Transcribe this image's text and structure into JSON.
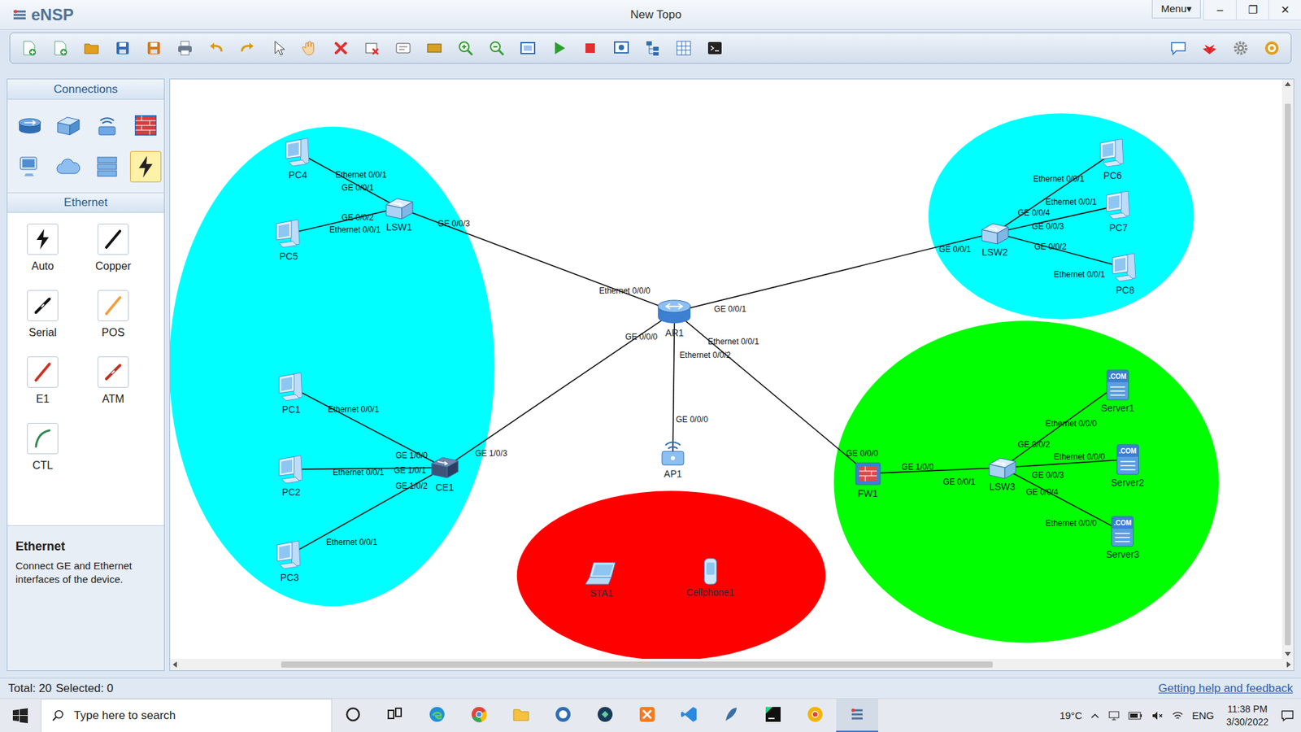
{
  "window": {
    "logo": "eNSP",
    "title": "New Topo",
    "menu": "Menu▾",
    "controls": [
      "–",
      "❐",
      "✕"
    ]
  },
  "palette": {
    "categories_title": "Connections",
    "categories": [
      {
        "kind": "router",
        "selected": false
      },
      {
        "kind": "switch",
        "selected": false
      },
      {
        "kind": "wlan",
        "selected": false
      },
      {
        "kind": "firewall",
        "selected": false
      },
      {
        "kind": "pc",
        "selected": false
      },
      {
        "kind": "cloud",
        "selected": false
      },
      {
        "kind": "other",
        "selected": false
      },
      {
        "kind": "connection",
        "selected": true
      }
    ],
    "cables_title": "Ethernet",
    "cables": [
      {
        "label": "Auto",
        "kind": "auto"
      },
      {
        "label": "Copper",
        "kind": "copper"
      },
      {
        "label": "Serial",
        "kind": "serial"
      },
      {
        "label": "POS",
        "kind": "pos"
      },
      {
        "label": "E1",
        "kind": "e1"
      },
      {
        "label": "ATM",
        "kind": "atm"
      },
      {
        "label": "CTL",
        "kind": "ctl"
      }
    ],
    "info": {
      "title": "Ethernet",
      "text": "Connect GE and Ethernet interfaces of the device."
    }
  },
  "topology": {
    "zones": [
      {
        "color": "#00ffff"
      },
      {
        "color": "#00ffff"
      },
      {
        "color": "#ff0000"
      },
      {
        "color": "#00ff00"
      }
    ],
    "nodes": [
      {
        "label": "PC4",
        "kind": "pc"
      },
      {
        "label": "PC5",
        "kind": "pc"
      },
      {
        "label": "LSW1",
        "kind": "switch"
      },
      {
        "label": "PC1",
        "kind": "pc"
      },
      {
        "label": "PC2",
        "kind": "pc"
      },
      {
        "label": "PC3",
        "kind": "pc"
      },
      {
        "label": "CE1",
        "kind": "ce"
      },
      {
        "label": "AR1",
        "kind": "router"
      },
      {
        "label": "AP1",
        "kind": "ap"
      },
      {
        "label": "STA1",
        "kind": "laptop"
      },
      {
        "label": "Cellphone1",
        "kind": "phone"
      },
      {
        "label": "LSW2",
        "kind": "switch"
      },
      {
        "label": "PC6",
        "kind": "pc"
      },
      {
        "label": "PC7",
        "kind": "pc"
      },
      {
        "label": "PC8",
        "kind": "pc"
      },
      {
        "label": "FW1",
        "kind": "firewall"
      },
      {
        "label": "LSW3",
        "kind": "switch"
      },
      {
        "label": "Server1",
        "kind": "server",
        "badge": ".COM"
      },
      {
        "label": "Server2",
        "kind": "server",
        "badge": ".COM"
      },
      {
        "label": "Server3",
        "kind": "server",
        "badge": ".COM"
      }
    ],
    "links": [
      {
        "a": "PC4",
        "a_port": "Ethernet 0/0/1",
        "b": "LSW1",
        "b_port": "GE 0/0/1"
      },
      {
        "a": "PC5",
        "a_port": "Ethernet 0/0/1",
        "b": "LSW1",
        "b_port": "GE 0/0/2"
      },
      {
        "a": "LSW1",
        "a_port": "GE 0/0/3",
        "b": "AR1",
        "b_port": "Ethernet 0/0/0"
      },
      {
        "a": "AR1",
        "a_port": "GE 0/0/1",
        "b": "LSW2",
        "b_port": "GE 0/0/1"
      },
      {
        "a": "AR1",
        "a_port": "GE 0/0/0",
        "b": "CE1",
        "b_port": "GE 1/0/3"
      },
      {
        "a": "AR1",
        "a_port": "Ethernet 0/0/2",
        "b": "AP1",
        "b_port": "GE 0/0/0"
      },
      {
        "a": "AR1",
        "a_port": "Ethernet 0/0/1",
        "b": "FW1",
        "b_port": "GE 0/0/0"
      },
      {
        "a": "PC1",
        "a_port": "Ethernet 0/0/1",
        "b": "CE1",
        "b_port": "GE 1/0/0"
      },
      {
        "a": "PC2",
        "a_port": "Ethernet 0/0/1",
        "b": "CE1",
        "b_port": "GE 1/0/1"
      },
      {
        "a": "PC3",
        "a_port": "Ethernet 0/0/1",
        "b": "CE1",
        "b_port": "GE 1/0/2"
      },
      {
        "a": "FW1",
        "a_port": "GE 1/0/0",
        "b": "LSW3",
        "b_port": "GE 0/0/1"
      },
      {
        "a": "LSW2",
        "a_port": "GE 0/0/4",
        "b": "PC6",
        "b_port": "Ethernet 0/0/1"
      },
      {
        "a": "LSW2",
        "a_port": "GE 0/0/3",
        "b": "PC7",
        "b_port": "Ethernet 0/0/1"
      },
      {
        "a": "LSW2",
        "a_port": "GE 0/0/2",
        "b": "PC8",
        "b_port": "Ethernet 0/0/1"
      },
      {
        "a": "LSW3",
        "a_port": "GE 0/0/2",
        "b": "Server1",
        "b_port": "Ethernet 0/0/0"
      },
      {
        "a": "LSW3",
        "a_port": "GE 0/0/3",
        "b": "Server2",
        "b_port": "Ethernet 0/0/0"
      },
      {
        "a": "LSW3",
        "a_port": "GE 0/0/4",
        "b": "Server3",
        "b_port": "Ethernet 0/0/0"
      }
    ]
  },
  "status_bar": {
    "total": "Total: 20",
    "selected": "Selected: 0",
    "help": "Getting help and feedback"
  },
  "taskbar": {
    "search": "Type here to search",
    "weather": "19°C",
    "language": "ENG",
    "time": "11:38 PM",
    "date": "3/30/2022"
  }
}
